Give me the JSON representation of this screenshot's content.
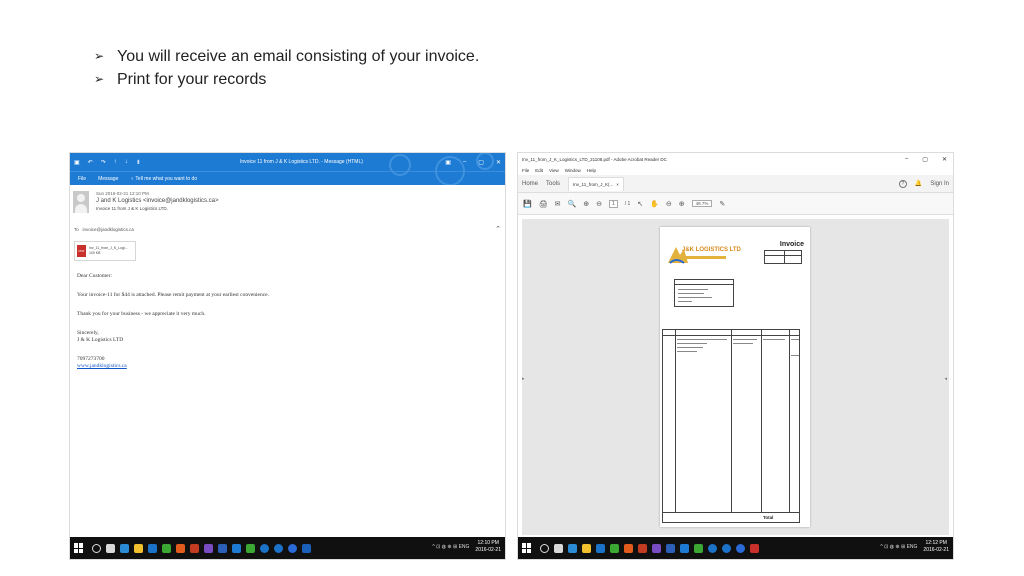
{
  "slide": {
    "bullet_marker": "➢",
    "bullets": [
      "You will receive an email consisting of your invoice.",
      "Print for your records"
    ]
  },
  "outlook": {
    "window_title": "Invoice 11 from J & K Logistics LTD. - Message (HTML)",
    "quick_access": [
      "▣",
      "↶",
      "↷",
      "↑",
      "↓",
      "⇟"
    ],
    "window_controls": [
      "▣",
      "–",
      "▢",
      "✕"
    ],
    "ribbon": [
      "File",
      "Message",
      "♀ Tell me what you want to do"
    ],
    "sent": "Sun 2016-02-21 12:10 PM",
    "from": "J and K Logistics <invoice@jandklogistics.ca>",
    "subject": "Invoice 11 from J & K Logistics LTD.",
    "to_label": "To",
    "to": "invoice@jandklogistics.ca",
    "attachment": {
      "name": "Inv_11_from_J_K_Logi...",
      "size": "100 KB"
    },
    "body": {
      "greeting": "Dear Customer:",
      "line1": "Your invoice-11 for $44 is attached. Please remit payment at your earliest convenience.",
      "line2": "Thank you for your business - we appreciate it very much.",
      "closing": "Sincerely,",
      "company": "J & K Logistics LTD",
      "phone": "7097273700",
      "website": "www.jandklogistics.ca"
    },
    "clock": {
      "time": "12:10 PM",
      "date": "2016-02-21"
    },
    "tray": "^ ⊡ ◍ ⊕ ⊞ ENG"
  },
  "reader": {
    "window_title": "Inv_11_from_J_K_Logistics_LTD_21108.pdf - Adobe Acrobat Reader DC",
    "window_controls": [
      "–",
      "▢",
      "✕"
    ],
    "menu": [
      "File",
      "Edit",
      "View",
      "Window",
      "Help"
    ],
    "tabs": {
      "home": "Home",
      "tools": "Tools",
      "doc": "Inv_11_from_J_K(...",
      "close": "×",
      "sign_in": "Sign In",
      "help": "?"
    },
    "toolbar": {
      "page": "1",
      "page_total": "/ 1",
      "zoom": "48.7%",
      "icons": [
        "💾",
        "🖨",
        "✉",
        "🔍",
        "⊕",
        "⊖",
        "↖",
        "✋",
        "⊖",
        "⊕",
        "✎"
      ]
    },
    "invoice": {
      "heading": "Invoice",
      "total_label": "Total",
      "logo_text": "J&K LOGISTICS LTD"
    },
    "nav": {
      "left": "▸",
      "right": "◂"
    },
    "clock": {
      "time": "12:12 PM",
      "date": "2016-02-21"
    },
    "tray": "^ ⊡ ◍ ⊕ ⊞ ENG"
  },
  "taskbar_colors": [
    "#d9d9d9",
    "#2a8ad4",
    "#f2c12e",
    "#1a73c9",
    "#3aa832",
    "#e25b1c",
    "#c23b22",
    "#7a4cc2",
    "#2b5fb8",
    "#1e7bd3",
    "#3aa832",
    "#1a73c9",
    "#1a73c9",
    "#2a6ad4"
  ]
}
